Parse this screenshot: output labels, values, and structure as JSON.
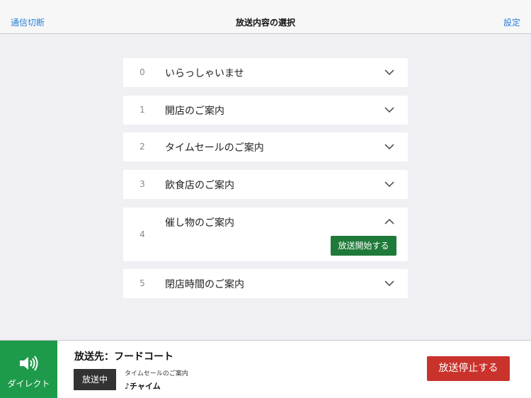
{
  "navbar": {
    "left_label": "通信切断",
    "title": "放送内容の選択",
    "right_label": "設定"
  },
  "items": [
    {
      "index": "0",
      "label": "いらっしゃいませ",
      "expanded": false
    },
    {
      "index": "1",
      "label": "開店のご案内",
      "expanded": false
    },
    {
      "index": "2",
      "label": "タイムセールのご案内",
      "expanded": false
    },
    {
      "index": "3",
      "label": "飲食店のご案内",
      "expanded": false
    },
    {
      "index": "4",
      "label": "催し物のご案内",
      "expanded": true,
      "action_label": "放送開始する"
    },
    {
      "index": "5",
      "label": "閉店時間のご案内",
      "expanded": false
    }
  ],
  "footer": {
    "direct_label": "ダイレクト",
    "destination": "放送先：フードコート",
    "status_badge": "放送中",
    "now_playing_title": "タイムセールのご案内",
    "now_playing_sub": "♪チャイム",
    "stop_label": "放送停止する"
  },
  "colors": {
    "accent_blue": "#2b7fd9",
    "start_green": "#1f7a3a",
    "direct_green": "#1e9b4a",
    "stop_red": "#c9332c"
  }
}
